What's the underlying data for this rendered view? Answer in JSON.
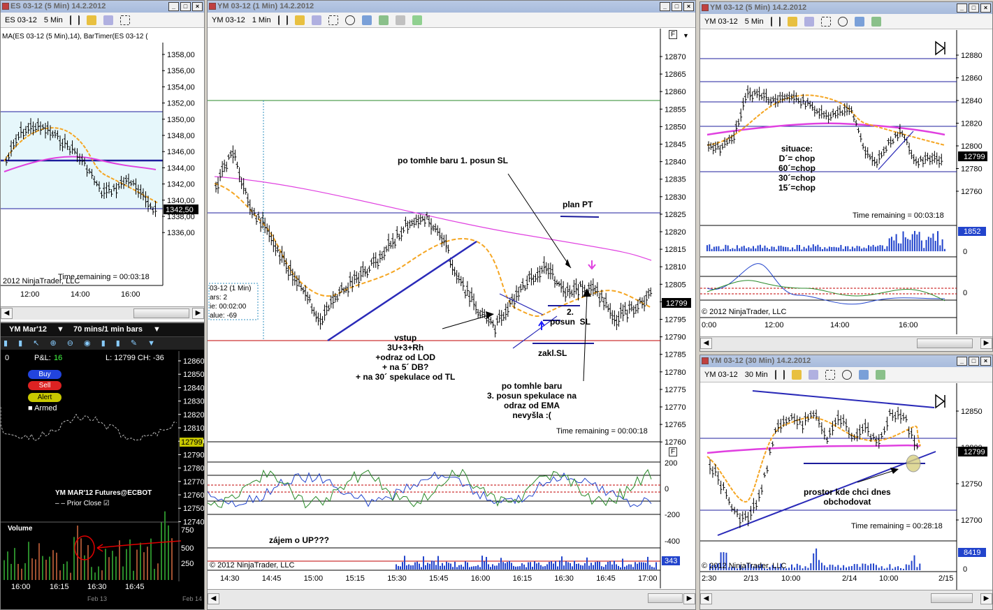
{
  "left_chart": {
    "title": "ES 03-12 (5 Min)  14.2.2012",
    "instrument": "ES 03-12",
    "interval": "5 Min",
    "indicators": "MA(ES 03-12 (5 Min),14), BarTimer(ES 03-12 (",
    "price_labels": [
      "1358,00",
      "1356,00",
      "1354,00",
      "1352,00",
      "1350,00",
      "1348,00",
      "1346,00",
      "1344,00",
      "1342,00",
      "1340,00",
      "1338,00",
      "1336,00"
    ],
    "last_price": "1342,50",
    "time_remaining": "Time remaining = 00:03:18",
    "copyright": "2012 NinjaTrader, LLC",
    "time_labels": [
      "12:00",
      "14:00",
      "16:00"
    ]
  },
  "chart_trader": {
    "instrument": "YM Mar'12",
    "bars": "70 mins/1 min bars",
    "pnl_label": "P&L:",
    "pnl_value": "16",
    "quantity": "0",
    "last_info": "L: 12799 CH: -36",
    "buy_label": "Buy",
    "sell_label": "Sell",
    "alert_label": "Alert",
    "armed_label": "Armed",
    "price_labels": [
      "12860",
      "12850",
      "12840",
      "12830",
      "12820",
      "12810",
      "12800",
      "12790",
      "12780",
      "12770",
      "12760",
      "12750",
      "12740"
    ],
    "last_price": "12799",
    "futures_label": "YM MAR'12 Futures@ECBOT",
    "prior_close_label": "Prior Close",
    "volume_label": "Volume",
    "volume_levels": [
      "750",
      "500",
      "250"
    ],
    "time_labels": [
      "16:00",
      "16:15",
      "16:30",
      "16:45"
    ],
    "date_label": "Feb 13",
    "date_label2": "Feb 14"
  },
  "center_chart": {
    "title": "YM 03-12 (1 Min)  14.2.2012",
    "instrument": "YM 03-12",
    "interval": "1 Min",
    "price_labels": [
      "12870",
      "12865",
      "12860",
      "12855",
      "12850",
      "12845",
      "12840",
      "12835",
      "12830",
      "12825",
      "12820",
      "12815",
      "12810",
      "12805",
      "12800",
      "12795",
      "12790",
      "12785",
      "12780",
      "12775",
      "12770",
      "12765",
      "12760"
    ],
    "last_price": "12799",
    "osc_labels": [
      "200",
      "0",
      "-200",
      "-400"
    ],
    "volume_last": "343",
    "time_remaining": "Time remaining = 00:00:18",
    "copyright": "2012 NinjaTrader, LLC",
    "time_labels": [
      "14:30",
      "14:45",
      "15:00",
      "15:15",
      "15:30",
      "15:45",
      "16:00",
      "16:15",
      "16:30",
      "16:45",
      "17:00"
    ],
    "databox": [
      "03-12 (1 Min)",
      "ars:  2",
      "ie:   00:02:00",
      "alue: -69"
    ],
    "annotations": {
      "posun1": "po tomhle baru 1. posun  SL",
      "plan_pt": "plan PT",
      "posun2": "2.\nposun  SL",
      "vstup": "vstup\n3U+3+Rh\n+odraz od LOD\n+ na 5´ DB?\n+ na 30´ spekulace od TL",
      "zakl_sl": "zakl.SL",
      "posun3": "po tomhle baru\n3. posun spekulace na\nodraz od EMA\nnevyšla :(",
      "zajem": "zájem o UP???"
    }
  },
  "right_top_chart": {
    "title": "YM 03-12 (5 Min)  14.2.2012",
    "instrument": "YM 03-12",
    "interval": "5 Min",
    "price_labels": [
      "12880",
      "12860",
      "12840",
      "12820",
      "12800",
      "12780",
      "12760"
    ],
    "last_price": "12799",
    "situace": "situace:\nD´= chop\n60´=chop\n30´=chop\n15´=chop",
    "time_remaining": "Time remaining = 00:03:18",
    "volume_last": "1852",
    "volume_zero": "0",
    "osc_zero": "0",
    "copyright": "2012 NinjaTrader, LLC",
    "time_labels": [
      "0:00",
      "12:00",
      "14:00",
      "16:00"
    ]
  },
  "right_bottom_chart": {
    "title": "YM 03-12 (30 Min)  14.2.2012",
    "instrument": "YM 03-12",
    "interval": "30 Min",
    "price_labels": [
      "12850",
      "12800",
      "12750",
      "12700"
    ],
    "last_price": "12799",
    "annotation": "prostor kde chci dnes\nobchodovat",
    "time_remaining": "Time remaining = 00:28:18",
    "volume_last": "8419",
    "volume_zero": "0",
    "copyright": "2012 NinjaTrader, LLC",
    "time_labels": [
      "2:30",
      "2/13",
      "10:00",
      "2/14",
      "10:00",
      "2/15"
    ]
  },
  "colors": {
    "ema": "#f5a623",
    "sma": "#e040e0",
    "hline": "#1c1c9c",
    "trendline": "#2a2ab8",
    "red_line": "#c00000"
  }
}
